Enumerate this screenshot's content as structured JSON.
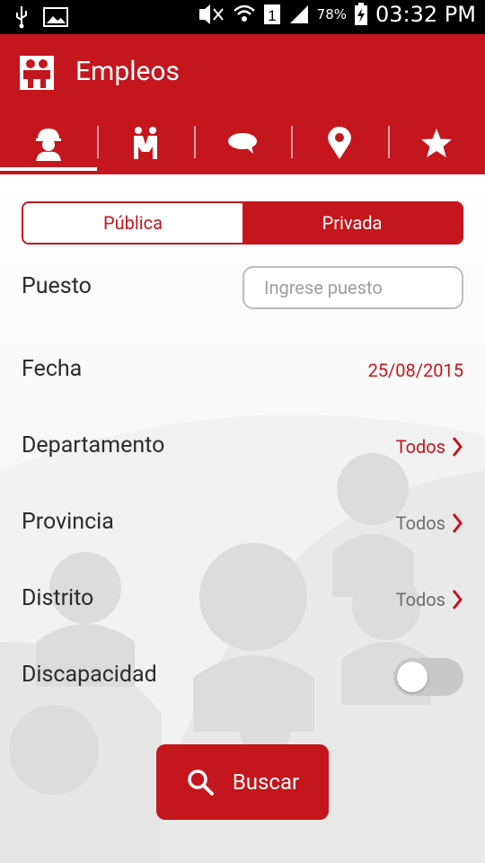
{
  "status_bar": {
    "battery_percent": "78%",
    "time": "03:32 PM",
    "sim_slot": "1",
    "icons": [
      "usb-icon",
      "image-icon",
      "mute-icon",
      "wifi-icon",
      "sim-icon",
      "signal-icon",
      "battery-charging-icon"
    ]
  },
  "app_bar": {
    "title": "Empleos",
    "logo_icon": "app-logo-icon",
    "tabs": [
      {
        "icon": "worker-icon",
        "active": true
      },
      {
        "icon": "people-icon",
        "active": false
      },
      {
        "icon": "chat-bubble-icon",
        "active": false
      },
      {
        "icon": "location-pin-icon",
        "active": false
      },
      {
        "icon": "star-icon",
        "active": false
      }
    ]
  },
  "segmented": {
    "publica_label": "Pública",
    "privada_label": "Privada",
    "selected": "Privada"
  },
  "form": {
    "puesto_label": "Puesto",
    "puesto_placeholder": "Ingrese puesto",
    "fecha_label": "Fecha",
    "fecha_value": "25/08/2015",
    "departamento_label": "Departamento",
    "departamento_value": "Todos",
    "provincia_label": "Provincia",
    "provincia_value": "Todos",
    "distrito_label": "Distrito",
    "distrito_value": "Todos",
    "discapacidad_label": "Discapacidad",
    "discapacidad_on": false
  },
  "search_button": {
    "label": "Buscar",
    "icon": "search-icon"
  },
  "colors": {
    "accent": "#c4161c",
    "disabled_text": "#6e6e6e"
  }
}
